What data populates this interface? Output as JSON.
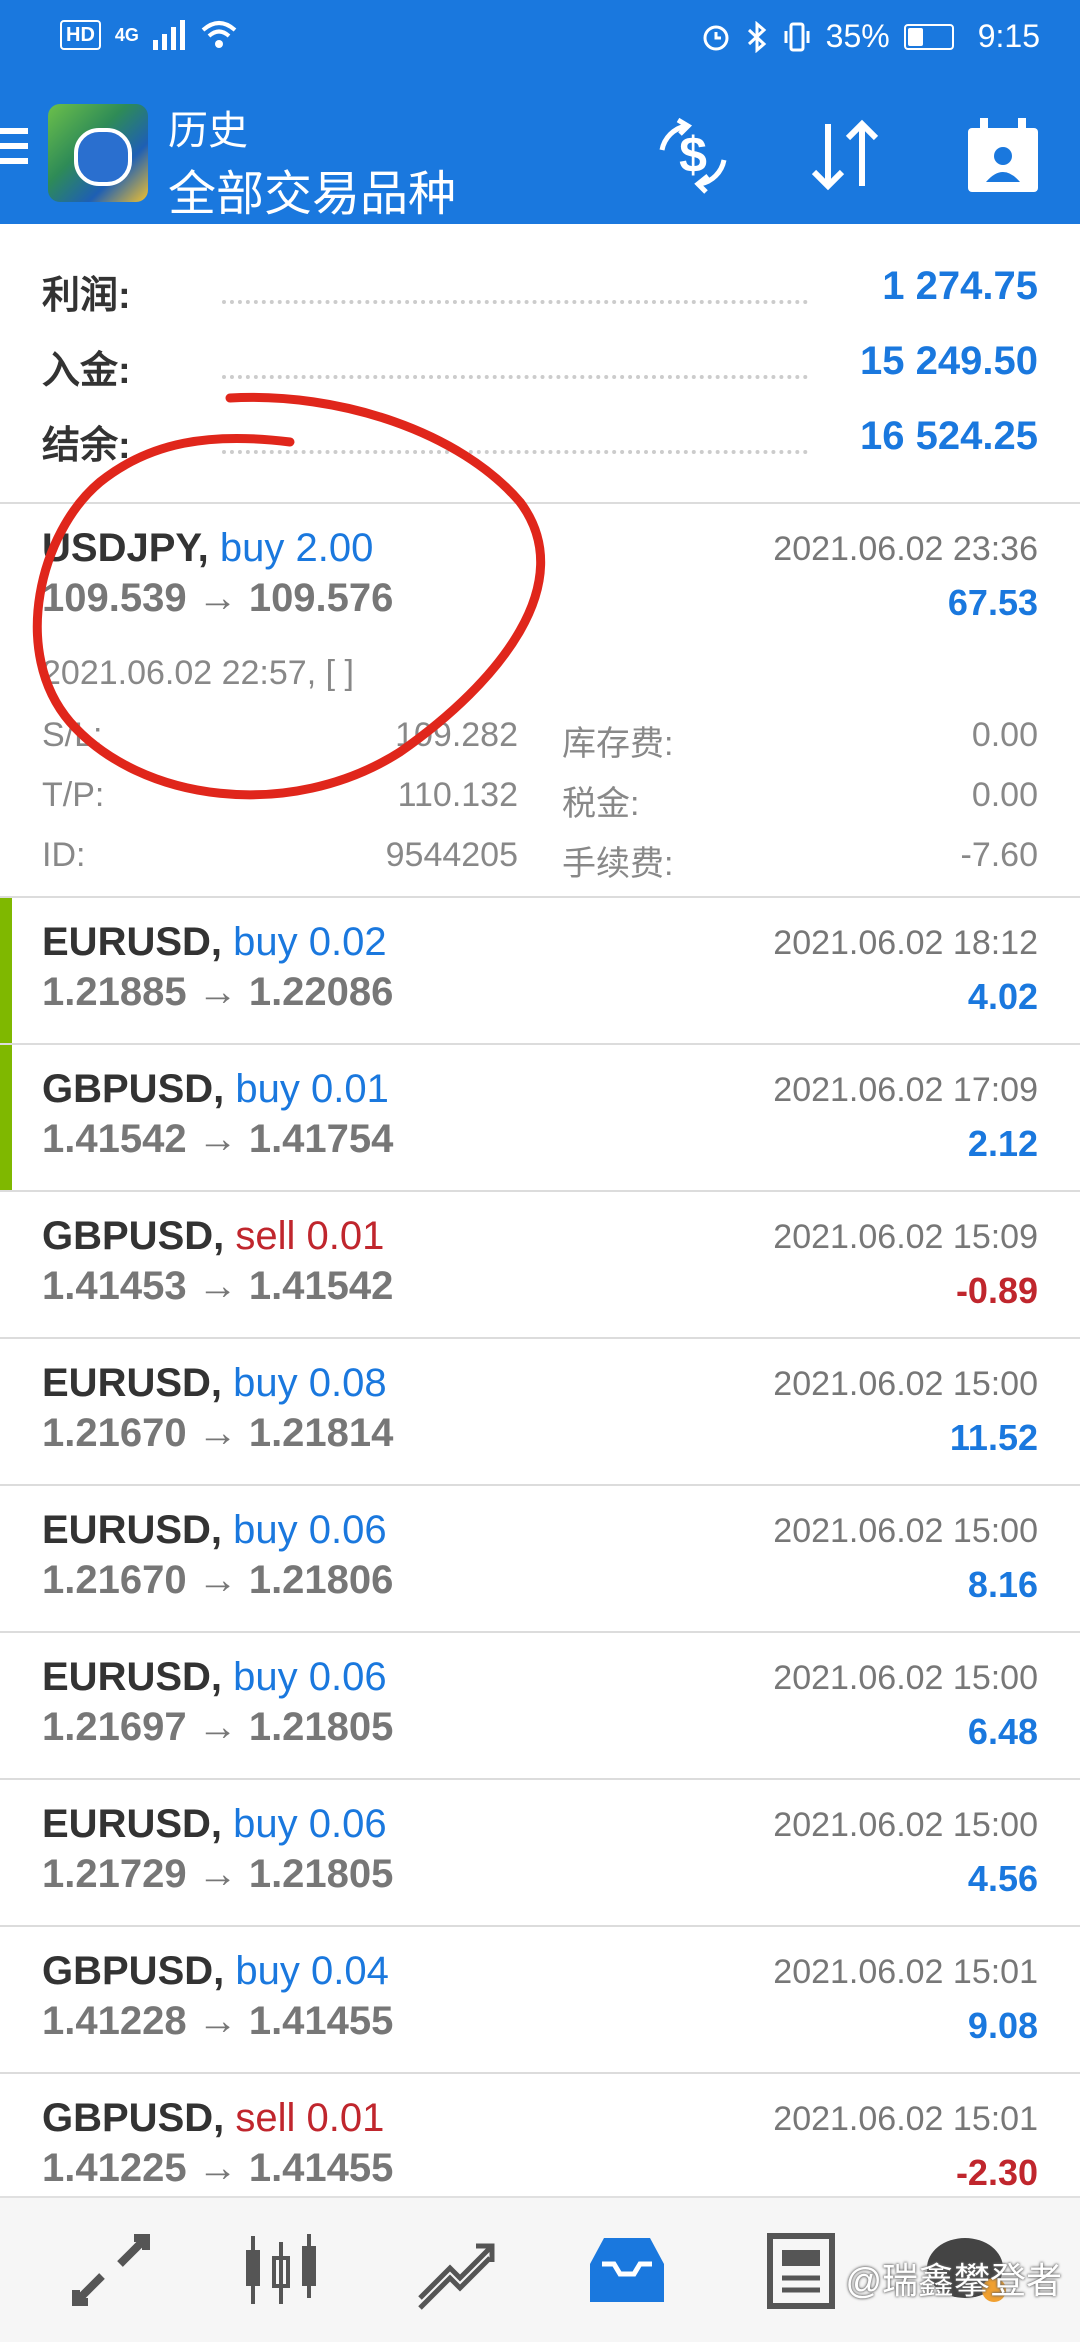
{
  "status_bar": {
    "hd": "HD",
    "network": "4G",
    "battery": "35%",
    "battery_level": 0.35,
    "time": "9:15"
  },
  "app_bar": {
    "title": "历史",
    "subtitle": "全部交易品种",
    "actions": [
      "currency-filter-icon",
      "sort-icon",
      "calendar-icon"
    ]
  },
  "summary": {
    "profit_label": "利润:",
    "profit_value": "1 274.75",
    "deposit_label": "入金:",
    "deposit_value": "15 249.50",
    "balance_label": "结余:",
    "balance_value": "16 524.25"
  },
  "expanded_trade": {
    "symbol": "USDJPY,",
    "direction": "buy 2.00",
    "prices": "109.539 → 109.576",
    "close_time": "2021.06.02 23:36",
    "profit": "67.53",
    "open_time": "2021.06.02 22:57,",
    "brackets": "[ ]",
    "sl_label": "S/L:",
    "sl_value": "109.282",
    "tp_label": "T/P:",
    "tp_value": "110.132",
    "id_label": "ID:",
    "id_value": "9544205",
    "swap_label": "库存费:",
    "swap_value": "0.00",
    "tax_label": "税金:",
    "tax_value": "0.00",
    "commission_label": "手续费:",
    "commission_value": "-7.60"
  },
  "trades": [
    {
      "symbol": "EURUSD,",
      "direction": "buy 0.02",
      "side": "buy",
      "prices": "1.21885 → 1.22086",
      "time": "2021.06.02 18:12",
      "profit": "4.02",
      "accent": true
    },
    {
      "symbol": "GBPUSD,",
      "direction": "buy 0.01",
      "side": "buy",
      "prices": "1.41542 → 1.41754",
      "time": "2021.06.02 17:09",
      "profit": "2.12",
      "accent": true
    },
    {
      "symbol": "GBPUSD,",
      "direction": "sell 0.01",
      "side": "sell",
      "prices": "1.41453 → 1.41542",
      "time": "2021.06.02 15:09",
      "profit": "-0.89",
      "accent": false
    },
    {
      "symbol": "EURUSD,",
      "direction": "buy 0.08",
      "side": "buy",
      "prices": "1.21670 → 1.21814",
      "time": "2021.06.02 15:00",
      "profit": "11.52",
      "accent": false
    },
    {
      "symbol": "EURUSD,",
      "direction": "buy 0.06",
      "side": "buy",
      "prices": "1.21670 → 1.21806",
      "time": "2021.06.02 15:00",
      "profit": "8.16",
      "accent": false
    },
    {
      "symbol": "EURUSD,",
      "direction": "buy 0.06",
      "side": "buy",
      "prices": "1.21697 → 1.21805",
      "time": "2021.06.02 15:00",
      "profit": "6.48",
      "accent": false
    },
    {
      "symbol": "EURUSD,",
      "direction": "buy 0.06",
      "side": "buy",
      "prices": "1.21729 → 1.21805",
      "time": "2021.06.02 15:00",
      "profit": "4.56",
      "accent": false
    },
    {
      "symbol": "GBPUSD,",
      "direction": "buy 0.04",
      "side": "buy",
      "prices": "1.41228 → 1.41455",
      "time": "2021.06.02 15:01",
      "profit": "9.08",
      "accent": false
    },
    {
      "symbol": "GBPUSD,",
      "direction": "sell 0.01",
      "side": "sell",
      "prices": "1.41225 → 1.41455",
      "time": "2021.06.02 15:01",
      "profit": "-2.30",
      "accent": false
    }
  ],
  "bottom_nav": {
    "items": [
      "quotes-icon",
      "chart-icon",
      "trade-icon",
      "history-icon",
      "news-icon",
      "messages-icon"
    ],
    "active": "history-icon",
    "watermark": "@瑞鑫攀登者"
  },
  "colors": {
    "primary": "#1a78de",
    "sell": "#c0262d",
    "accent_bar": "#7fb800",
    "annotation": "#e0261b"
  }
}
